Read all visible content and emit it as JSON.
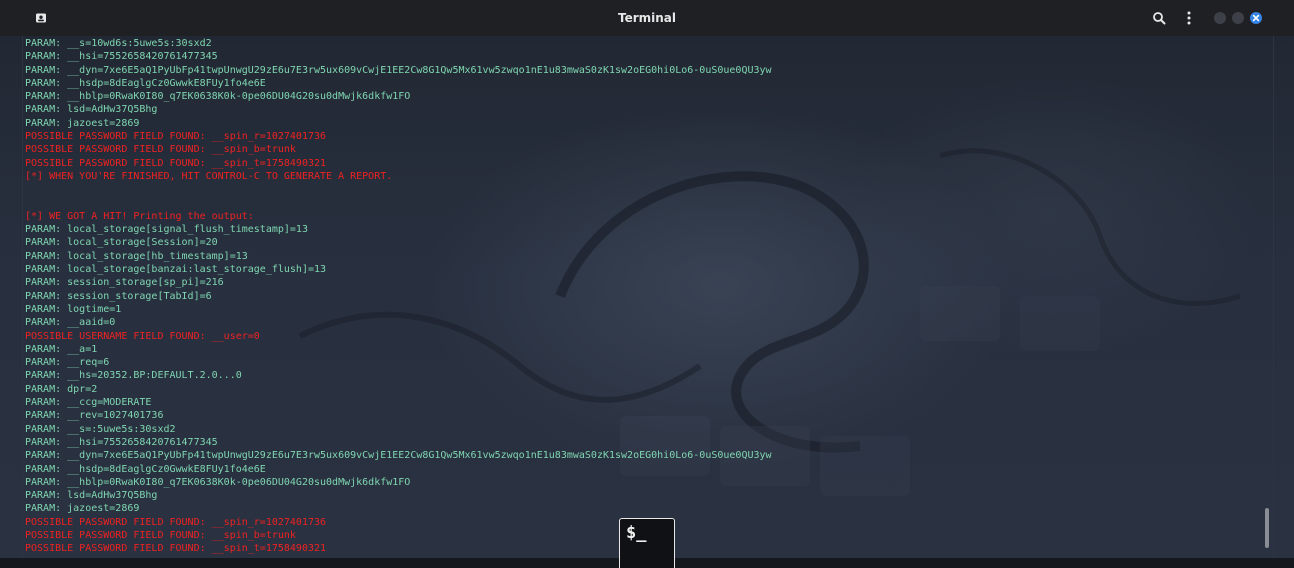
{
  "window": {
    "title": "Terminal"
  },
  "icons": {
    "app": "terminal-app-icon",
    "search": "search-icon",
    "menu": "kebab-menu-icon",
    "minimize": "minimize-icon",
    "maximize": "maximize-icon",
    "close": "close-icon"
  },
  "colors": {
    "param_text": "#7fd6b0",
    "alert_text": "#ee2222",
    "close_button": "#3584e4"
  },
  "terminal": {
    "lines": [
      {
        "kind": "param",
        "text": "PARAM: __s=10wd6s:5uwe5s:30sxd2"
      },
      {
        "kind": "param",
        "text": "PARAM: __hsi=7552658420761477345"
      },
      {
        "kind": "param",
        "text": "PARAM: __dyn=7xe6E5aQ1PyUbFp41twpUnwgU29zE6u7E3rw5ux609vCwjE1EE2Cw8G1Qw5Mx61vw5zwqo1nE1u83mwaS0zK1sw2oEG0hi0Lo6-0uS0ue0QU3yw"
      },
      {
        "kind": "param",
        "text": "PARAM: __hsdp=8dEaglgCz0GwwkE8FUy1fo4e6E"
      },
      {
        "kind": "param",
        "text": "PARAM: __hblp=0RwaK0I80_q7EK0638K0k-0pe06DU04G20su0dMwjk6dkfw1FO"
      },
      {
        "kind": "param",
        "text": "PARAM: lsd=AdHw37Q5Bhg"
      },
      {
        "kind": "param",
        "text": "PARAM: jazoest=2869"
      },
      {
        "kind": "alert",
        "text": "POSSIBLE PASSWORD FIELD FOUND: __spin_r=1027401736"
      },
      {
        "kind": "alert",
        "text": "POSSIBLE PASSWORD FIELD FOUND: __spin_b=trunk"
      },
      {
        "kind": "alert",
        "text": "POSSIBLE PASSWORD FIELD FOUND: __spin_t=1758490321"
      },
      {
        "kind": "alert",
        "text": "[*] WHEN YOU'RE FINISHED, HIT CONTROL-C TO GENERATE A REPORT."
      },
      {
        "kind": "blank",
        "text": " "
      },
      {
        "kind": "blank",
        "text": " "
      },
      {
        "kind": "alert",
        "text": "[*] WE GOT A HIT! Printing the output:"
      },
      {
        "kind": "param",
        "text": "PARAM: local_storage[signal_flush_timestamp]=13"
      },
      {
        "kind": "param",
        "text": "PARAM: local_storage[Session]=20"
      },
      {
        "kind": "param",
        "text": "PARAM: local_storage[hb_timestamp]=13"
      },
      {
        "kind": "param",
        "text": "PARAM: local_storage[banzai:last_storage_flush]=13"
      },
      {
        "kind": "param",
        "text": "PARAM: session_storage[sp_pi]=216"
      },
      {
        "kind": "param",
        "text": "PARAM: session_storage[TabId]=6"
      },
      {
        "kind": "param",
        "text": "PARAM: logtime=1"
      },
      {
        "kind": "param",
        "text": "PARAM: __aaid=0"
      },
      {
        "kind": "alert",
        "text": "POSSIBLE USERNAME FIELD FOUND: __user=0"
      },
      {
        "kind": "param",
        "text": "PARAM: __a=1"
      },
      {
        "kind": "param",
        "text": "PARAM: __req=6"
      },
      {
        "kind": "param",
        "text": "PARAM: __hs=20352.BP:DEFAULT.2.0...0"
      },
      {
        "kind": "param",
        "text": "PARAM: dpr=2"
      },
      {
        "kind": "param",
        "text": "PARAM: __ccg=MODERATE"
      },
      {
        "kind": "param",
        "text": "PARAM: __rev=1027401736"
      },
      {
        "kind": "param",
        "text": "PARAM: __s=:5uwe5s:30sxd2"
      },
      {
        "kind": "param",
        "text": "PARAM: __hsi=7552658420761477345"
      },
      {
        "kind": "param",
        "text": "PARAM: __dyn=7xe6E5aQ1PyUbFp41twpUnwgU29zE6u7E3rw5ux609vCwjE1EE2Cw8G1Qw5Mx61vw5zwqo1nE1u83mwaS0zK1sw2oEG0hi0Lo6-0uS0ue0QU3yw"
      },
      {
        "kind": "param",
        "text": "PARAM: __hsdp=8dEaglgCz0GwwkE8FUy1fo4e6E"
      },
      {
        "kind": "param",
        "text": "PARAM: __hblp=0RwaK0I80_q7EK0638K0k-0pe06DU04G20su0dMwjk6dkfw1FO"
      },
      {
        "kind": "param",
        "text": "PARAM: lsd=AdHw37Q5Bhg"
      },
      {
        "kind": "param",
        "text": "PARAM: jazoest=2869"
      },
      {
        "kind": "alert",
        "text": "POSSIBLE PASSWORD FIELD FOUND: __spin_r=1027401736"
      },
      {
        "kind": "alert",
        "text": "POSSIBLE PASSWORD FIELD FOUND: __spin_b=trunk"
      },
      {
        "kind": "alert",
        "text": "POSSIBLE PASSWORD FIELD FOUND: __spin_t=1758490321"
      }
    ]
  },
  "dock": {
    "terminal_glyph": "$_"
  }
}
